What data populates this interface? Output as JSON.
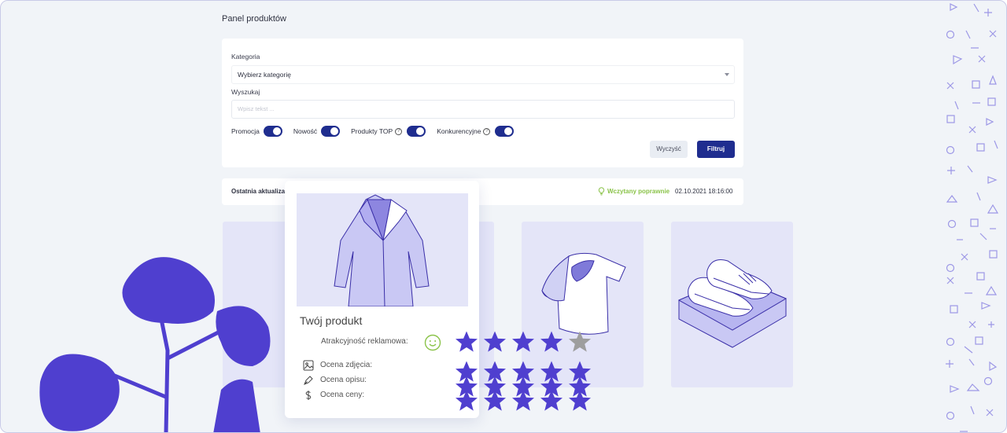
{
  "page": {
    "title": "Panel produktów"
  },
  "filters": {
    "category_label": "Kategoria",
    "category_value": "Wybierz kategorię",
    "search_label": "Wyszukaj",
    "search_placeholder": "Wpisz tekst ...",
    "toggles": [
      {
        "label": "Promocja",
        "on": true
      },
      {
        "label": "Nowość",
        "on": true
      },
      {
        "label": "Produkty TOP",
        "on": true
      },
      {
        "label": "Konkurencyjne",
        "on": true
      }
    ],
    "clear_label": "Wyczyść",
    "filter_label": "Filtruj"
  },
  "status": {
    "last_update_label": "Ostatnia aktualiza",
    "state": "Wczytany poprawnie",
    "datetime": "02.10.2021 18:16:00"
  },
  "product_card": {
    "title": "Twój produkt",
    "attractiveness_label": "Atrakcyjność reklamowa:",
    "attractiveness_rating": 4,
    "photo_label": "Ocena zdjęcia:",
    "photo_rating": 5,
    "description_label": "Ocena opisu:",
    "description_rating": 5,
    "price_label": "Ocena ceny:",
    "price_rating": 5
  },
  "colors": {
    "accent": "#1f2d8f",
    "star": "#4f3fcf",
    "star_empty": "#9e9e9e",
    "success": "#8bc34a",
    "plant": "#4f3fcf",
    "tile": "#e4e5f8"
  },
  "icons": [
    "chevron-down-icon",
    "help-icon",
    "bulb-icon",
    "smiley-icon",
    "image-icon",
    "pen-icon",
    "dollar-icon",
    "star-icon"
  ]
}
